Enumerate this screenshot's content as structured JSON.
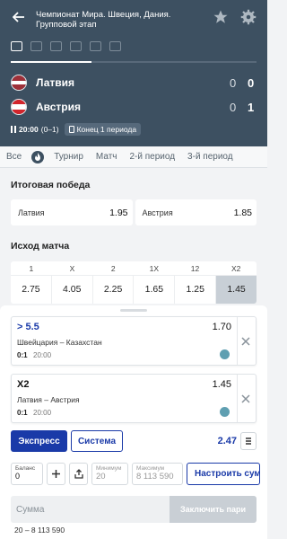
{
  "header": {
    "title": "Чемпионат Мира. Швеция, Дания. Групповой этап",
    "team1": {
      "name": "Латвия",
      "score_p": "0",
      "score": "0"
    },
    "team2": {
      "name": "Австрия",
      "score_p": "0",
      "score": "1"
    },
    "time": "20:00",
    "period_score": "(0–1)",
    "period_status": "Конец 1 периода"
  },
  "tabs": [
    "Все",
    "Турнир",
    "Матч",
    "2-й период",
    "3-й период"
  ],
  "sections": {
    "winner_title": "Итоговая победа",
    "outcome_title": "Исход матча"
  },
  "winner": [
    {
      "label": "Латвия",
      "odd": "1.95"
    },
    {
      "label": "Австрия",
      "odd": "1.85"
    }
  ],
  "outcome": {
    "heads": [
      "1",
      "X",
      "2",
      "1X",
      "12",
      "X2"
    ],
    "values": [
      "2.75",
      "4.05",
      "2.25",
      "1.65",
      "1.25",
      "1.45"
    ]
  },
  "bets": [
    {
      "type": "> 5.5",
      "odd": "1.70",
      "match": "Швейцария – Казахстан",
      "score": "0:1",
      "time": "20:00"
    },
    {
      "type": "X2",
      "odd": "1.45",
      "match": "Латвия – Австрия",
      "score": "0:1",
      "time": "20:00"
    }
  ],
  "slip": {
    "express": "Экспресс",
    "system": "Система",
    "total_odd": "2.47",
    "balance_label": "Баланс",
    "balance_value": "0",
    "min_label": "Минимум",
    "min_value": "20",
    "max_label": "Максимум",
    "max_value": "8 113 590",
    "setup_button": "Настроить сумму",
    "sum_placeholder": "Сумма",
    "place_button": "Заключить пари",
    "range": "20 – 8 113 590"
  },
  "colors": {
    "header_bg": "#3d5061",
    "accent": "#1a3aa8"
  }
}
